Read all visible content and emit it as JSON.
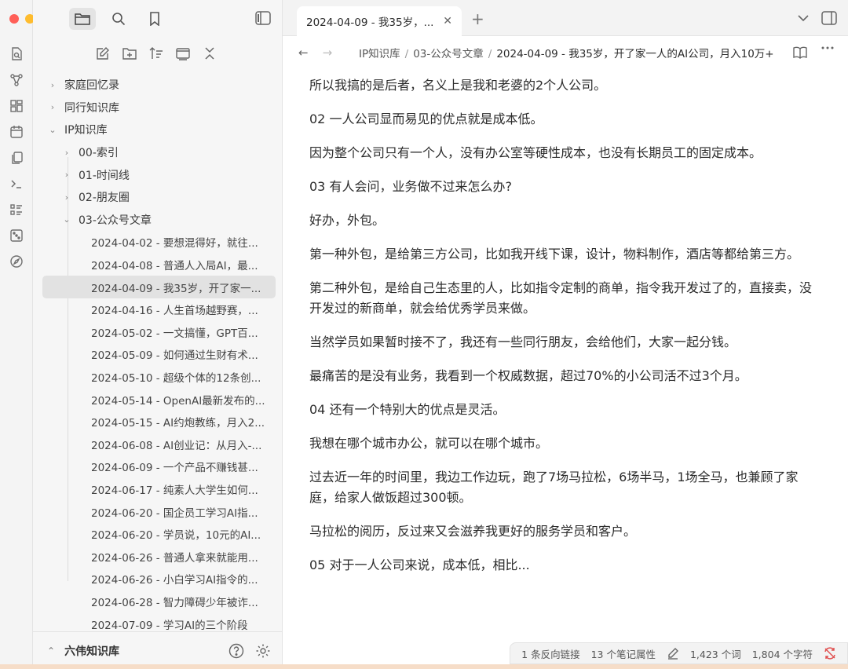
{
  "sidebar": {
    "tree": [
      {
        "label": "家庭回忆录",
        "level": 0,
        "state": "collapsed"
      },
      {
        "label": "同行知识库",
        "level": 0,
        "state": "collapsed"
      },
      {
        "label": "IP知识库",
        "level": 0,
        "state": "expanded"
      },
      {
        "label": "00-索引",
        "level": 1,
        "state": "collapsed"
      },
      {
        "label": "01-时间线",
        "level": 1,
        "state": "collapsed"
      },
      {
        "label": "02-朋友圈",
        "level": 1,
        "state": "collapsed"
      },
      {
        "label": "03-公众号文章",
        "level": 1,
        "state": "expanded"
      }
    ],
    "files": [
      {
        "label": "2024-04-02 - 要想混得好，就往..."
      },
      {
        "label": "2024-04-08 - 普通人入局AI，最..."
      },
      {
        "label": "2024-04-09 - 我35岁，开了家一...",
        "selected": true
      },
      {
        "label": "2024-04-16 - 人生首场越野赛，..."
      },
      {
        "label": "2024-05-02 - 一文搞懂，GPT百..."
      },
      {
        "label": "2024-05-09 - 如何通过生财有术..."
      },
      {
        "label": "2024-05-10 - 超级个体的12条创..."
      },
      {
        "label": "2024-05-14 - OpenAI最新发布的..."
      },
      {
        "label": "2024-05-15 - AI约炮教练，月入2..."
      },
      {
        "label": "2024-06-08 - AI创业记：从月入-..."
      },
      {
        "label": "2024-06-09 - 一个产品不赚钱甚..."
      },
      {
        "label": "2024-06-17 - 纯素人大学生如何..."
      },
      {
        "label": "2024-06-20 - 国企员工学习AI指..."
      },
      {
        "label": "2024-06-20 - 学员说，10元的AI..."
      },
      {
        "label": "2024-06-26 - 普通人拿来就能用..."
      },
      {
        "label": "2024-06-26 - 小白学习AI指令的..."
      },
      {
        "label": "2024-06-28 - 智力障碍少年被诈..."
      },
      {
        "label": "2024-07-09 - 学习AI的三个阶段"
      }
    ],
    "vault_name": "六伟知识库"
  },
  "tab": {
    "title": "2024-04-09 - 我35岁，..."
  },
  "breadcrumb": [
    "IP知识库",
    "03-公众号文章",
    "2024-04-09 - 我35岁，开了家一人的AI公司，月入10万+"
  ],
  "content": {
    "paragraphs": [
      "所以我搞的是后者，名义上是我和老婆的2个人公司。",
      "02 一人公司显而易见的优点就是成本低。",
      "因为整个公司只有一个人，没有办公室等硬性成本，也没有长期员工的固定成本。",
      "03 有人会问，业务做不过来怎么办?",
      "好办，外包。",
      "第一种外包，是给第三方公司，比如我开线下课，设计，物料制作，酒店等都给第三方。",
      "第二种外包，是给自己生态里的人，比如指令定制的商单，指令我开发过了的，直接卖，没开发过的新商单，就会给优秀学员来做。",
      "当然学员如果暂时接不了，我还有一些同行朋友，会给他们，大家一起分钱。",
      "最痛苦的是没有业务，我看到一个权威数据，超过70%的小公司活不过3个月。",
      "04 还有一个特别大的优点是灵活。",
      "我想在哪个城市办公，就可以在哪个城市。",
      "过去近一年的时间里，我边工作边玩，跑了7场马拉松，6场半马，1场全马，也兼顾了家庭，给家人做饭超过300顿。",
      "马拉松的阅历，反过来又会滋养我更好的服务学员和客户。",
      "05 对于一人公司来说，成本低，相比..."
    ]
  },
  "status": {
    "backlinks": "1 条反向链接",
    "properties": "13 个笔记属性",
    "words": "1,423 个词",
    "chars": "1,804 个字符"
  },
  "colors": {
    "accent_sync": "#e05050",
    "selected_bg": "#e2e2e2"
  }
}
